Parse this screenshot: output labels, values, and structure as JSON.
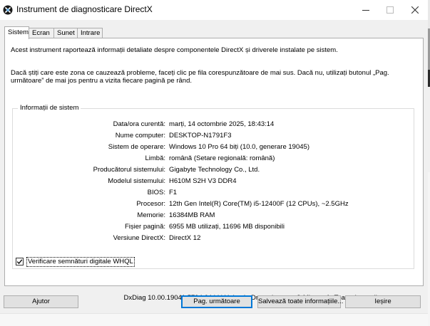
{
  "window": {
    "title": "Instrument de diagnosticare DirectX",
    "accent_color": "#0078d7"
  },
  "tabs": [
    {
      "label": "Sistem",
      "active": true
    },
    {
      "label": "Ecran",
      "active": false
    },
    {
      "label": "Sunet",
      "active": false
    },
    {
      "label": "Intrare",
      "active": false
    }
  ],
  "intro": {
    "line1": "Acest instrument raportează informații detaliate despre componentele DirectX și driverele instalate pe sistem.",
    "line2": "Dacă știți care este zona ce cauzează probleme, faceți clic pe fila corespunzătoare de mai sus. Dacă nu, utilizați butonul „Pag. următoare” de mai jos pentru a vizita fiecare pagină pe rând."
  },
  "system_info": {
    "legend": "Informații de sistem",
    "rows": [
      {
        "label": "Data/ora curentă:",
        "value": "marți, 14 octombrie 2025, 18:43:14"
      },
      {
        "label": "Nume computer:",
        "value": "DESKTOP-N1791F3"
      },
      {
        "label": "Sistem de operare:",
        "value": "Windows 10 Pro 64 biți (10.0, generare 19045)"
      },
      {
        "label": "Limbă:",
        "value": "română (Setare regională: română)"
      },
      {
        "label": "Producătorul sistemului:",
        "value": "Gigabyte Technology Co., Ltd."
      },
      {
        "label": "Modelul sistemului:",
        "value": "H610M S2H V3 DDR4"
      },
      {
        "label": "BIOS:",
        "value": "F1"
      },
      {
        "label": "Procesor:",
        "value": "12th Gen Intel(R) Core(TM) i5-12400F (12 CPUs), ~2.5GHz"
      },
      {
        "label": "Memorie:",
        "value": "16384MB RAM"
      },
      {
        "label": "Fișier pagină:",
        "value": "6955 MB utilizați, 11696 MB disponibili"
      },
      {
        "label": "Versiune DirectX:",
        "value": "DirectX 12"
      }
    ]
  },
  "whql": {
    "label": "Verificare semnături digitale WHQL",
    "checked": true
  },
  "footer": {
    "text": "DxDiag 10.00.19041.5794 64 biți Unicode  Drept de autor © Microsoft. Toate drepturile rezervate."
  },
  "buttons": {
    "help": "Ajutor",
    "next": "Pag. următoare",
    "save": "Salvează toate informațiile...",
    "exit": "Ieșire"
  },
  "icons": {
    "app": "directx-icon",
    "minimize": "minimize-icon",
    "maximize": "maximize-icon",
    "close": "close-icon",
    "check": "checkmark-icon"
  }
}
